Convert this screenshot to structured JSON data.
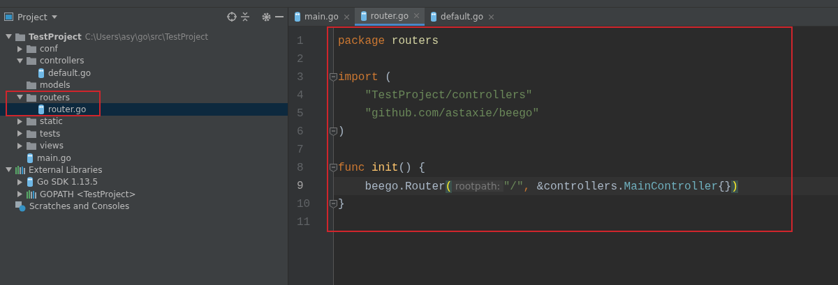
{
  "project_panel": {
    "title": "Project",
    "tree": [
      {
        "label": "TestProject",
        "path": "C:\\Users\\asy\\go\\src\\TestProject",
        "kind": "module",
        "expandable": true,
        "expanded": true,
        "selected": false,
        "highlighted": false,
        "children": [
          {
            "label": "conf",
            "kind": "folder",
            "expandable": true,
            "expanded": false,
            "selected": false,
            "highlighted": false
          },
          {
            "label": "controllers",
            "kind": "folder",
            "expandable": true,
            "expanded": true,
            "selected": false,
            "highlighted": false,
            "children": [
              {
                "label": "default.go",
                "kind": "go-file",
                "expandable": false,
                "selected": false,
                "highlighted": false
              }
            ]
          },
          {
            "label": "models",
            "kind": "folder",
            "expandable": false,
            "selected": false,
            "highlighted": false
          },
          {
            "label": "routers",
            "kind": "folder",
            "expandable": true,
            "expanded": true,
            "selected": false,
            "highlighted": true,
            "children": [
              {
                "label": "router.go",
                "kind": "go-file",
                "expandable": false,
                "selected": true,
                "highlighted": true
              }
            ]
          },
          {
            "label": "static",
            "kind": "folder",
            "expandable": true,
            "expanded": false,
            "selected": false,
            "highlighted": false
          },
          {
            "label": "tests",
            "kind": "folder",
            "expandable": true,
            "expanded": false,
            "selected": false,
            "highlighted": false
          },
          {
            "label": "views",
            "kind": "folder",
            "expandable": true,
            "expanded": false,
            "selected": false,
            "highlighted": false
          },
          {
            "label": "main.go",
            "kind": "go-file",
            "expandable": false,
            "selected": false,
            "highlighted": false
          }
        ]
      },
      {
        "label": "External Libraries",
        "kind": "library",
        "expandable": true,
        "expanded": true,
        "selected": false,
        "highlighted": false,
        "children": [
          {
            "label": "Go SDK 1.13.5",
            "kind": "go-file",
            "expandable": true,
            "expanded": false,
            "selected": false,
            "highlighted": false
          },
          {
            "label": "GOPATH <TestProject>",
            "kind": "library",
            "expandable": true,
            "expanded": false,
            "selected": false,
            "highlighted": false
          }
        ]
      },
      {
        "label": "Scratches and Consoles",
        "kind": "scratches",
        "expandable": false,
        "selected": false,
        "highlighted": false
      }
    ]
  },
  "editor": {
    "highlighted": true,
    "tabs": [
      {
        "label": "main.go",
        "selected": false
      },
      {
        "label": "router.go",
        "selected": true
      },
      {
        "label": "default.go",
        "selected": false
      }
    ],
    "lines": [
      {
        "number": "1",
        "fold": false,
        "current": false,
        "tokens": [
          {
            "text": "package ",
            "kind": "keyword"
          },
          {
            "text": "routers",
            "kind": "package"
          }
        ]
      },
      {
        "number": "2",
        "fold": false,
        "current": false
      },
      {
        "number": "3",
        "fold": true,
        "current": false,
        "tokens": [
          {
            "text": "import",
            "kind": "keyword"
          },
          {
            "text": " (",
            "kind": "plain"
          }
        ]
      },
      {
        "number": "4",
        "fold": false,
        "current": false,
        "tokens": [
          {
            "text": "    \"TestProject/controllers\"",
            "kind": "string"
          }
        ]
      },
      {
        "number": "5",
        "fold": false,
        "current": false,
        "tokens": [
          {
            "text": "    \"github.com/astaxie/beego\"",
            "kind": "string"
          }
        ]
      },
      {
        "number": "6",
        "fold": true,
        "current": false,
        "tokens": [
          {
            "text": ")",
            "kind": "plain"
          }
        ]
      },
      {
        "number": "7",
        "fold": false,
        "current": false
      },
      {
        "number": "8",
        "fold": true,
        "current": false,
        "tokens": [
          {
            "text": "func ",
            "kind": "keyword"
          },
          {
            "text": "init",
            "kind": "function"
          },
          {
            "text": "() {",
            "kind": "plain"
          }
        ]
      },
      {
        "number": "9",
        "fold": false,
        "current": true,
        "tokens": [
          {
            "text": "    beego.",
            "kind": "plain"
          },
          {
            "text": "Router",
            "kind": "method"
          },
          {
            "text": "(",
            "kind": "brace"
          },
          {
            "text": " rootpath: ",
            "kind": "hint"
          },
          {
            "text": "\"/\"",
            "kind": "string"
          },
          {
            "text": ",",
            "kind": "keyword"
          },
          {
            "text": " &controllers.",
            "kind": "plain"
          },
          {
            "text": "MainController",
            "kind": "type"
          },
          {
            "text": "{}",
            "kind": "plain"
          },
          {
            "text": ")",
            "kind": "brace"
          }
        ]
      },
      {
        "number": "10",
        "fold": true,
        "current": false,
        "tokens": [
          {
            "text": "}",
            "kind": "plain"
          }
        ]
      },
      {
        "number": "11",
        "fold": false,
        "current": false
      }
    ]
  }
}
